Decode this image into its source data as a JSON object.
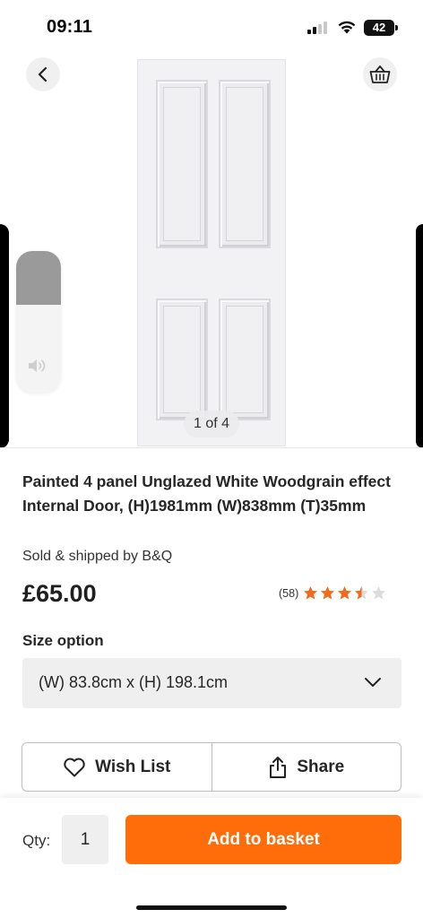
{
  "status_bar": {
    "time": "09:11",
    "battery": "42"
  },
  "gallery": {
    "counter": "1 of 4",
    "back_icon": "chevron-left-icon",
    "basket_icon": "basket-icon"
  },
  "volume_hud": {
    "level": 0.38,
    "icon": "speaker-icon"
  },
  "product": {
    "title": "Painted 4 panel Unglazed White Woodgrain effect Internal Door, (H)1981mm (W)838mm (T)35mm",
    "seller": "Sold & shipped by B&Q",
    "price": "£65.00",
    "rating_count": "(58)",
    "rating_value": 3.5,
    "rating_max": 5
  },
  "size": {
    "label": "Size option",
    "selected": "(W) 83.8cm x (H) 198.1cm"
  },
  "actions": {
    "wishlist_label": "Wish List",
    "share_label": "Share"
  },
  "bottom_bar": {
    "qty_label": "Qty:",
    "qty_value": "1",
    "add_label": "Add to basket"
  },
  "colors": {
    "accent": "#ff6c0a",
    "star_filled": "#f26a1b",
    "star_empty": "#dcdcdc"
  }
}
